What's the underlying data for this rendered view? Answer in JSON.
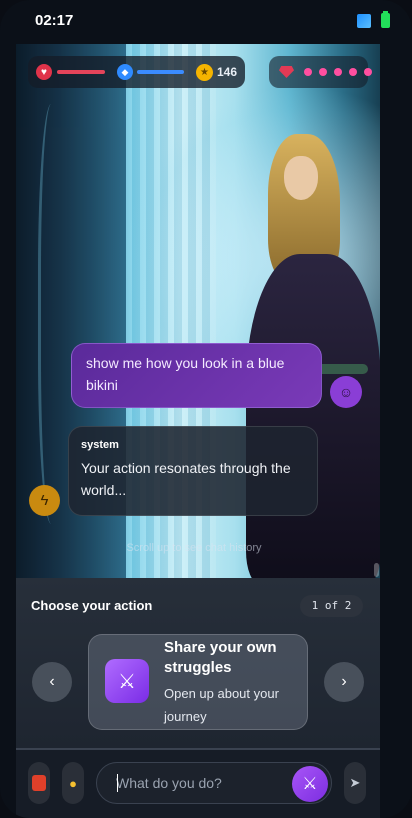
{
  "status_bar": {
    "time": "02:17"
  },
  "hud": {
    "health_icon": "heart-icon",
    "health_level": 1.0,
    "mana_icon": "mana-icon",
    "mana_level": 1.0,
    "coins": "146",
    "gems_icon": "gem-icon",
    "gems_count": 5
  },
  "chat": {
    "user_message": "show me how you look in a blue bikini",
    "system_sender": "system",
    "system_message": "Your action resonates through the world...",
    "scroll_hint": "Scroll up to see chat history"
  },
  "actions": {
    "title": "Choose your action",
    "page": "1 of 2",
    "card": {
      "icon": "crossed-swords-icon",
      "title": "Share your own struggles",
      "description": "Open up about your journey"
    }
  },
  "input": {
    "placeholder": "What do you do?"
  },
  "colors": {
    "accent": "#8b3ddb",
    "health": "#e4445a",
    "mana": "#3b8cff",
    "coin": "#f5b400",
    "gem": "#ff4fa0"
  }
}
